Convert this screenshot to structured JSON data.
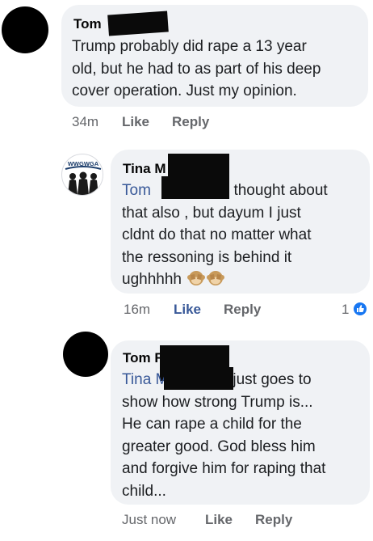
{
  "comments": [
    {
      "author_visible": "Tom",
      "mention": "",
      "lines": [
        "Trump probably did rape a 13 year",
        "old, but he had to as part of his deep",
        "cover operation. Just my opinion."
      ],
      "time": "34m",
      "like_label": "Like",
      "reply_label": "Reply"
    },
    {
      "author_visible": "Tina M",
      "avatar_text": "WWGWGA",
      "mention": "Tom",
      "first_line_rest": "I thought about",
      "lines": [
        "that also , but dayum I just",
        "cldnt do that no matter what",
        "the ressoning is behind it",
        "ughhhhh"
      ],
      "emoji": [
        "see-no-evil-monkey",
        "see-no-evil-monkey"
      ],
      "time": "16m",
      "like_label": "Like",
      "reply_label": "Reply",
      "reaction_count": "1",
      "reaction_icon": "like-reaction-icon"
    },
    {
      "author_visible": "Tom R",
      "mention": "Tina M",
      "first_line_rest": "just goes to",
      "lines": [
        "show how strong Trump is...",
        "He can rape a child for the",
        "greater good. God bless him",
        "and forgive him for raping that",
        "child..."
      ],
      "time": "Just now",
      "like_label": "Like",
      "reply_label": "Reply"
    }
  ],
  "colors": {
    "bubble": "#f0f2f5",
    "mention": "#385898",
    "meta": "#65676b",
    "like_blue": "#1877f2"
  }
}
